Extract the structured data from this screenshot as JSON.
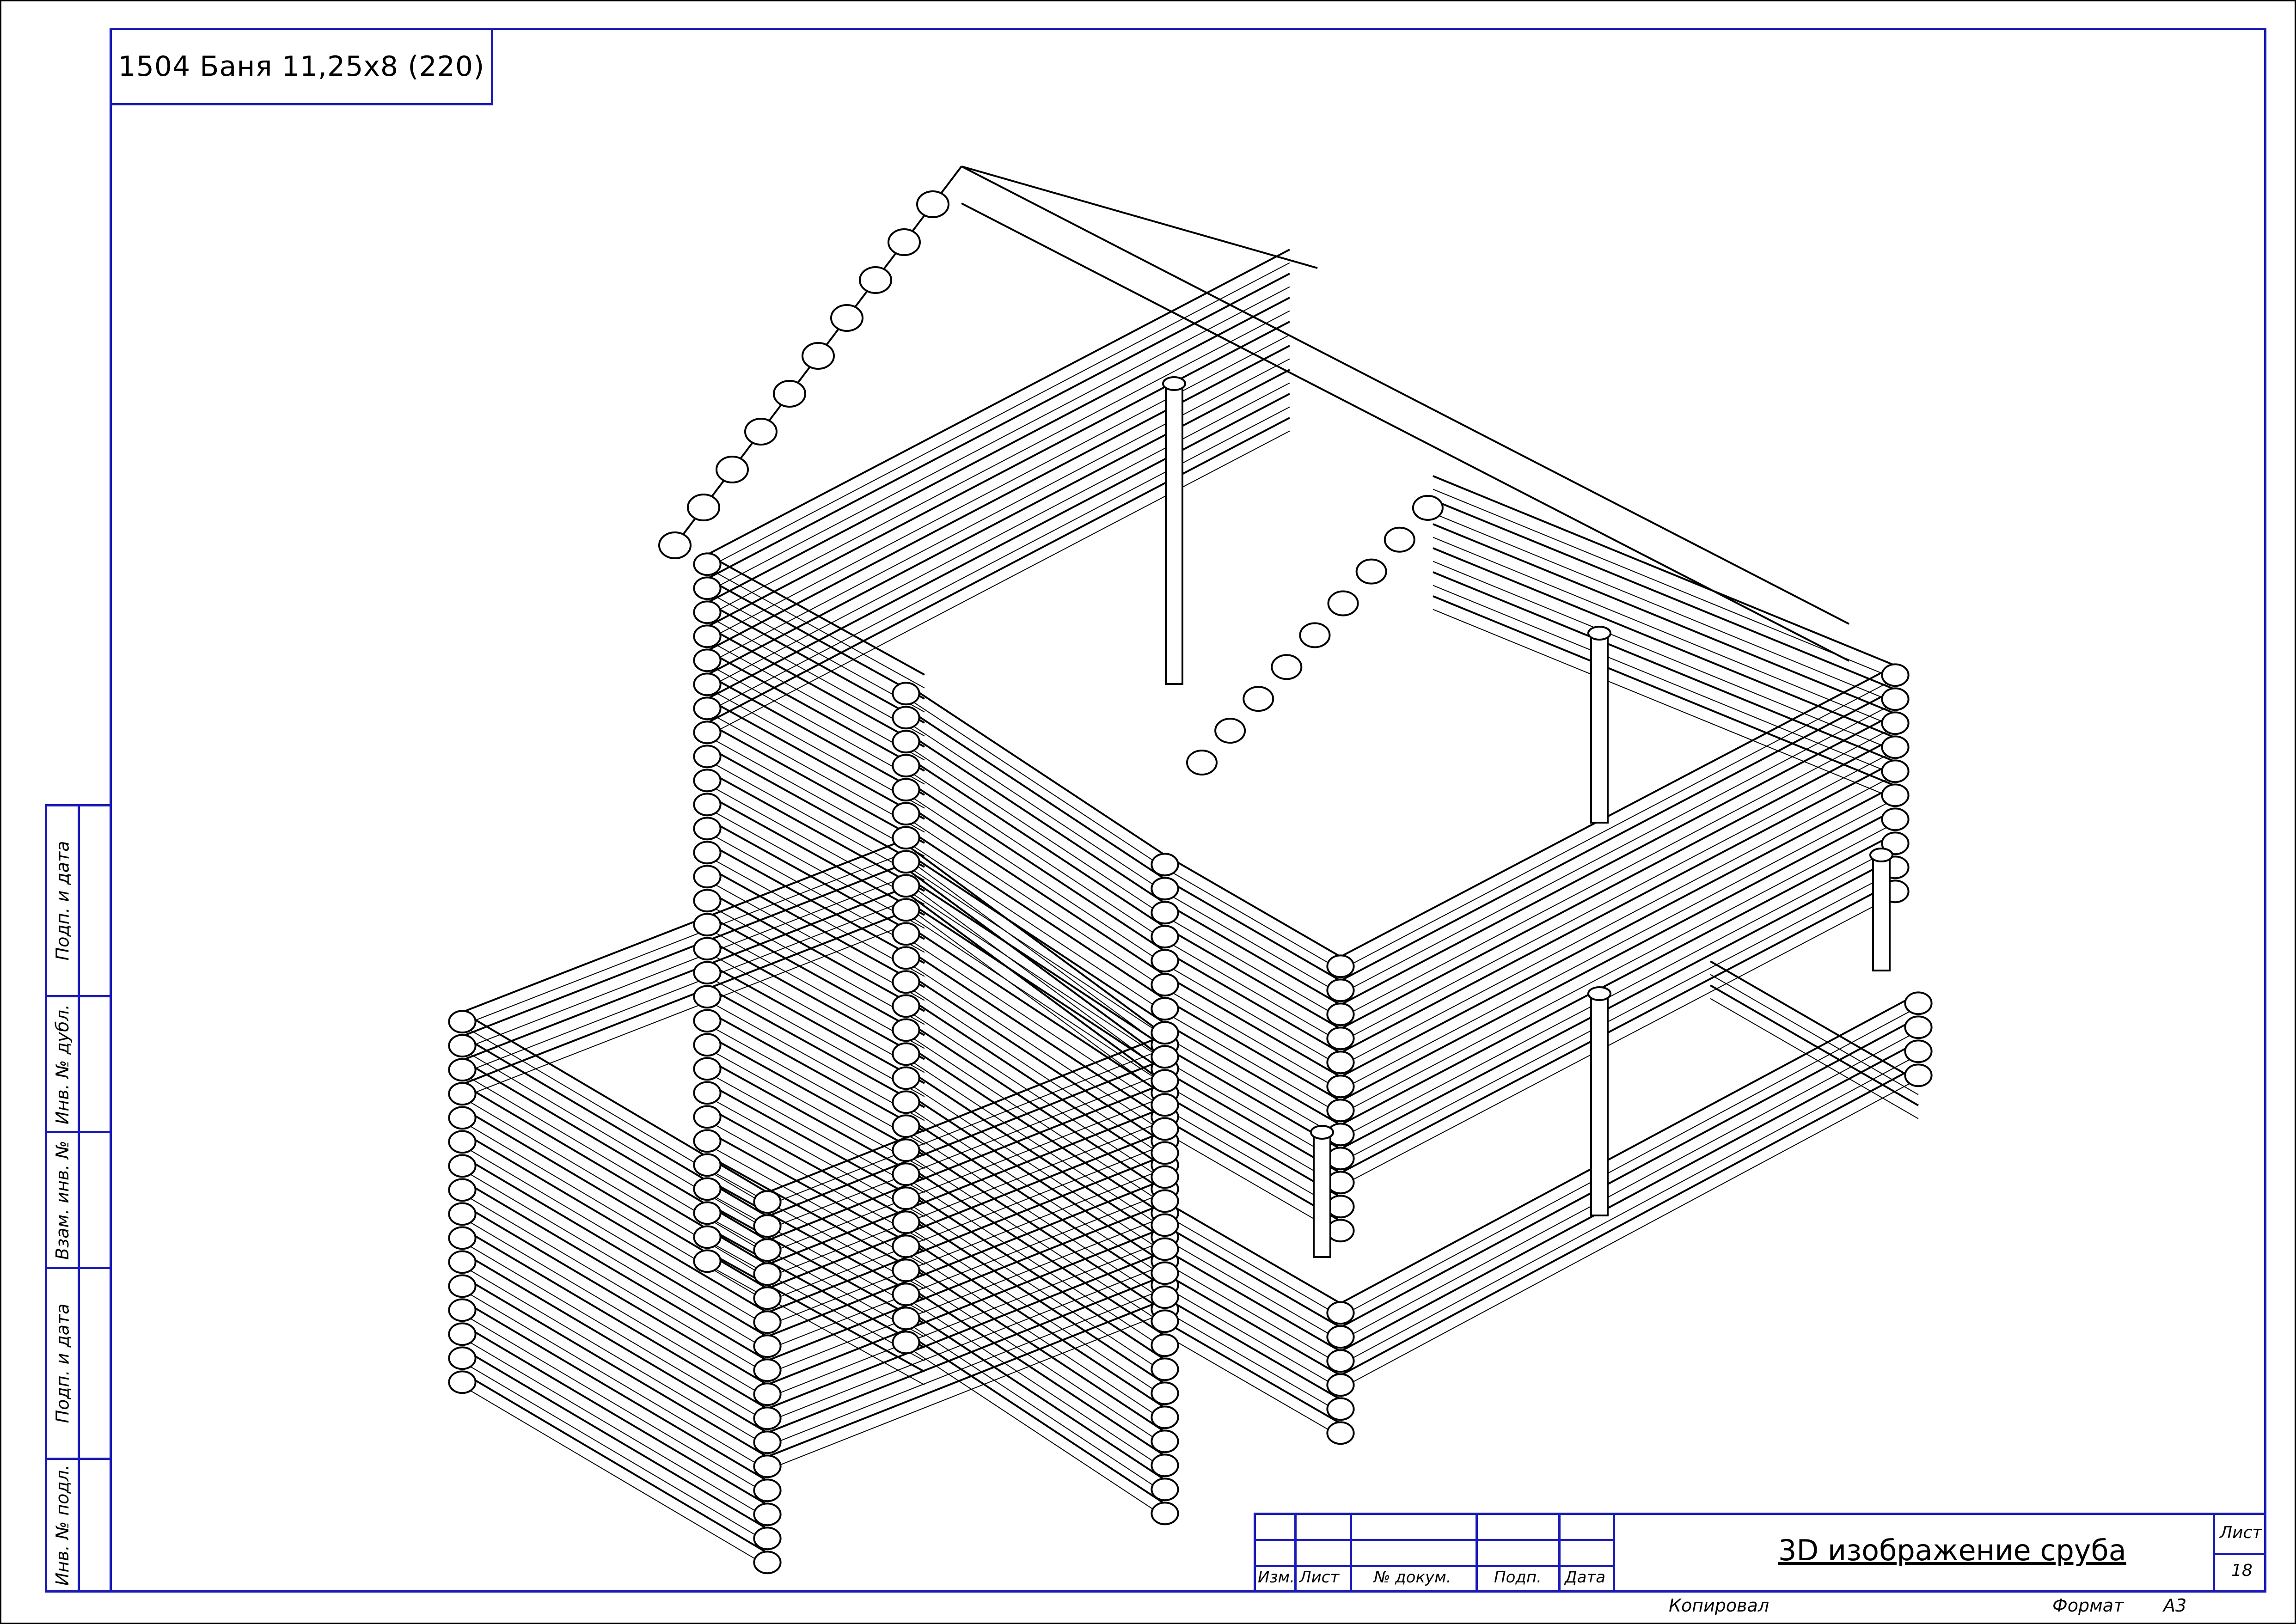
{
  "header": {
    "title": "1504 Баня 11,25х8 (220)"
  },
  "side_stamp": {
    "labels": [
      "Подп. и дата",
      "Инв. № дубл.",
      "Взам. инв. №",
      "Подп. и дата",
      "Инв. № подл."
    ]
  },
  "title_block": {
    "columns": [
      "Изм.",
      "Лист",
      "№ докум.",
      "Подп.",
      "Дата"
    ],
    "document_title": "3D изображение сруба",
    "sheet_label": "Лист",
    "sheet_number": "18"
  },
  "footer": {
    "copied_label": "Копировал",
    "format_label": "Формат",
    "format_value": "А3"
  },
  "colors": {
    "frame": "#1a1ab8",
    "lines": "#000000",
    "accent": "#8b0000"
  }
}
